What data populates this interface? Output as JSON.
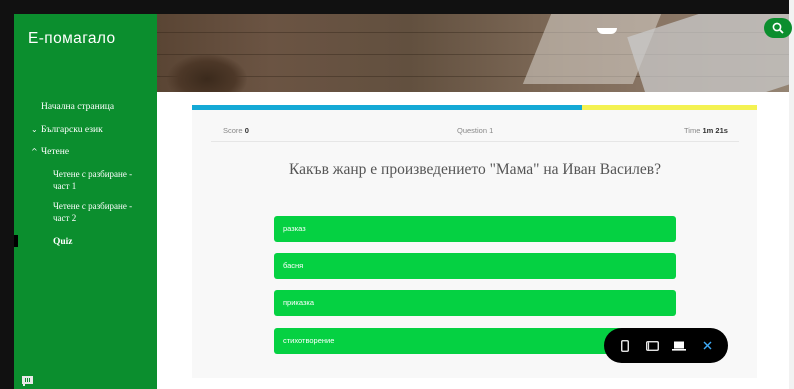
{
  "sidebar": {
    "title": "Е-помагало",
    "items": [
      {
        "label": "Начална страница",
        "chevron": ""
      },
      {
        "label": "Българскu език",
        "chevron": "⌄"
      },
      {
        "label": "Четене",
        "chevron": "^"
      },
      {
        "label": "Четене с разбиране - част 1",
        "chevron": ""
      },
      {
        "label": "Четене с разбиране - част 2",
        "chevron": ""
      },
      {
        "label": "Quiz",
        "chevron": ""
      }
    ]
  },
  "quiz": {
    "score_label": "Score",
    "score_value": "0",
    "question_label": "Question 1",
    "time_label": "Time",
    "time_value": "1m 21s",
    "question_text": "Какъв жанр е произведението \"Мама\" на Иван Василев?",
    "answers": [
      "разказ",
      "басня",
      "приказка",
      "стихотворение"
    ],
    "progress": 0.69
  },
  "colors": {
    "sidebar": "#0b8e2e",
    "answer": "#05d142",
    "progress_fill": "#14a9d6",
    "progress_rest": "#f4f252"
  },
  "icons": {
    "search": "search-icon",
    "report": "flag-icon",
    "mobile": "mobile-view-icon",
    "tablet": "tablet-view-icon",
    "desktop": "desktop-view-icon",
    "close": "close-icon"
  }
}
